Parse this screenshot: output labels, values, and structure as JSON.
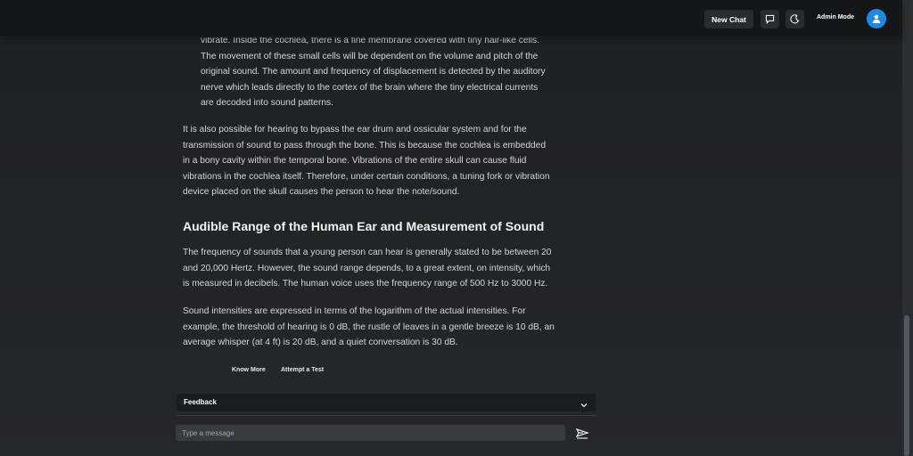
{
  "header": {
    "new_chat_label": "New Chat",
    "chat_icon": "chat-bubble-icon",
    "theme_icon": "moon-icon",
    "admin_mode_label": "Admin Mode",
    "avatar_icon": "user-icon"
  },
  "article": {
    "list_lines": [
      "vibrate. Inside the cochlea, there is a fine membrane covered with tiny hair-like cells.",
      "The movement of these small cells will be dependent on the volume and pitch of the",
      "original sound. The amount and frequency of displacement is detected by the auditory",
      "nerve which leads directly to the cortex of the brain where the tiny electrical currents",
      "are decoded into sound patterns."
    ],
    "para1_lines": [
      "It is also possible for hearing to bypass the ear drum and ossicular system and for the",
      "transmission of sound to pass through the bone. This is because the cochlea is embedded",
      "in a bony cavity within the temporal bone. Vibrations of the entire skull can cause fluid",
      "vibrations in the cochlea itself. Therefore, under certain conditions, a tuning fork or vibration",
      "device placed on the skull causes the person to hear the note/sound."
    ],
    "heading": "Audible Range of the Human Ear and Measurement of Sound",
    "para2_lines": [
      "The frequency of sounds that a young person can hear is generally stated to be between 20",
      "and 20,000 Hertz. However, the sound range depends, to a great extent, on intensity, which",
      "is measured in decibels. The human voice uses the frequency range of 500 Hz to 3000 Hz."
    ],
    "para3_lines": [
      "Sound intensities are expressed in terms of the logarithm of the actual intensities. For",
      "example, the threshold of hearing is 0 dB, the rustle of leaves in a gentle breeze is 10 dB, an",
      "average whisper (at 4 ft) is 20 dB, and a quiet conversation is 30 dB."
    ]
  },
  "actions": {
    "know_more": "Know More",
    "attempt_test": "Attempt a Test"
  },
  "feedback": {
    "label": "Feedback",
    "chevron_icon": "chevron-down-icon"
  },
  "composer": {
    "placeholder": "Type a message",
    "send_icon": "send-icon"
  }
}
